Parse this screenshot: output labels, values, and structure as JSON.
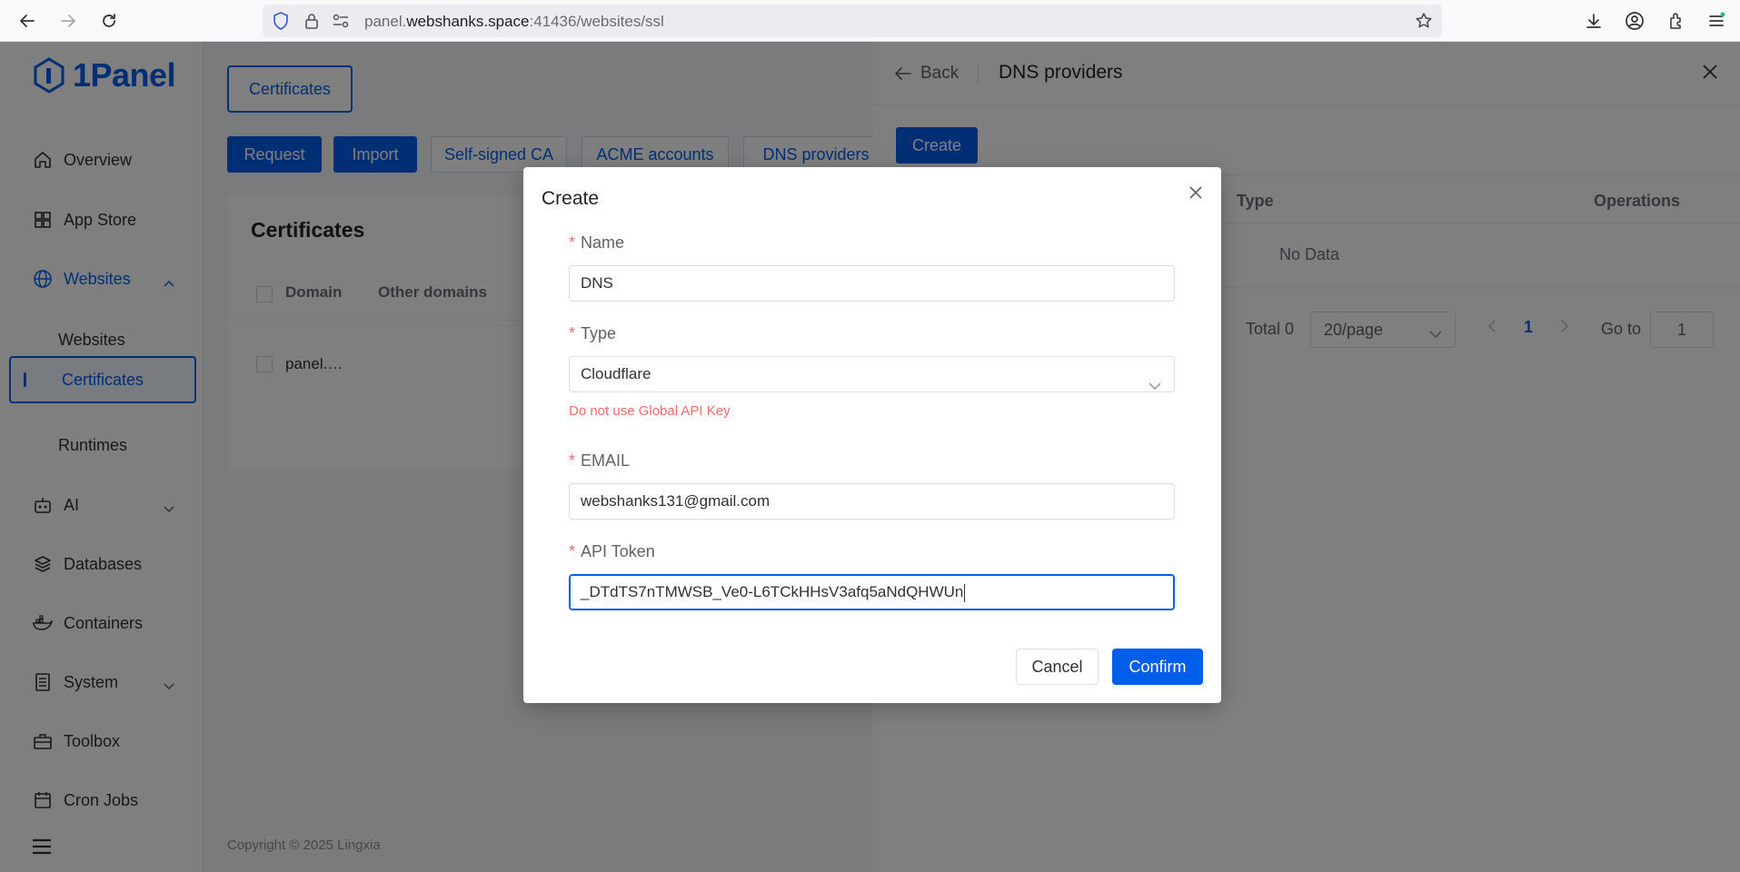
{
  "browser": {
    "url_prefix": "panel.",
    "url_host": "webshanks.space",
    "url_rest": ":41436/websites/ssl"
  },
  "app": {
    "logo_text": "1Panel",
    "sidebar": {
      "items": [
        {
          "label": "Overview",
          "icon": "home-icon"
        },
        {
          "label": "App Store",
          "icon": "grid-icon"
        },
        {
          "label": "Websites",
          "icon": "globe-icon"
        },
        {
          "label": "AI",
          "icon": "robot-icon"
        },
        {
          "label": "Databases",
          "icon": "layers-icon"
        },
        {
          "label": "Containers",
          "icon": "docker-icon"
        },
        {
          "label": "System",
          "icon": "server-icon"
        },
        {
          "label": "Toolbox",
          "icon": "toolbox-icon"
        },
        {
          "label": "Cron Jobs",
          "icon": "calendar-icon"
        }
      ],
      "sub_items": [
        "Websites",
        "Certificates",
        "Runtimes"
      ]
    },
    "main": {
      "tab_label": "Certificates",
      "actions": [
        "Request",
        "Import",
        "Self-signed CA",
        "ACME accounts",
        "DNS providers"
      ],
      "card_title": "Certificates",
      "columns": [
        "Domain",
        "Other domains"
      ],
      "row_domain": "panel.…",
      "footer": "Copyright © 2025 Lingxia"
    }
  },
  "drawer": {
    "back_label": "Back",
    "title": "DNS providers",
    "create_label": "Create",
    "columns": {
      "type": "Type",
      "operations": "Operations"
    },
    "empty_text": "No Data",
    "pager": {
      "total": "Total 0",
      "page_size": "20/page",
      "current_page": "1",
      "goto_label": "Go to",
      "goto_value": "1"
    }
  },
  "dialog": {
    "title": "Create",
    "fields": {
      "name": {
        "label": "Name",
        "value": "DNS"
      },
      "type": {
        "label": "Type",
        "value": "Cloudflare",
        "hint": "Do not use Global API Key"
      },
      "email": {
        "label": "EMAIL",
        "value": "webshanks131@gmail.com"
      },
      "api_token": {
        "label": "API Token",
        "value": "_DTdTS7nTMWSB_Ve0-L6TCkHHsV3afq5aNdQHWUn"
      }
    },
    "cancel_label": "Cancel",
    "confirm_label": "Confirm"
  },
  "colors": {
    "primary": "#005eeb",
    "error": "#f56c6c",
    "mask": "rgba(0,0,0,0.5)"
  }
}
